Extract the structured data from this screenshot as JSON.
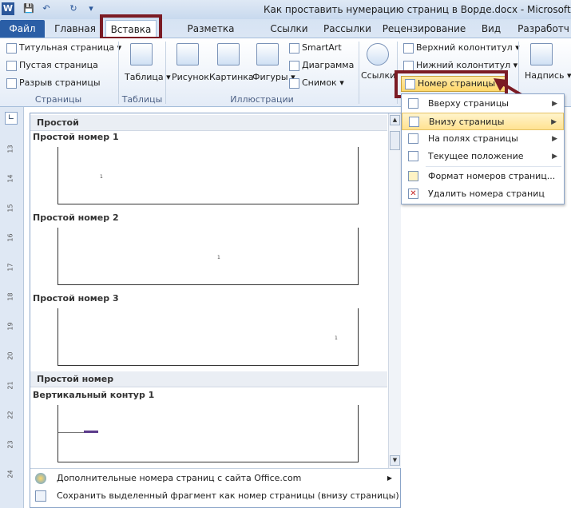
{
  "window": {
    "title": "Как проставить нумерацию страниц в Ворде.docx - Microsoft Word"
  },
  "tabs": [
    "Файл",
    "Главная",
    "Вставка",
    "Разметка страницы",
    "Ссылки",
    "Рассылки",
    "Рецензирование",
    "Вид",
    "Разработч"
  ],
  "ribbon": {
    "pages": {
      "title_page": "Титульная страница",
      "blank_page": "Пустая страница",
      "page_break": "Разрыв страницы",
      "group": "Страницы"
    },
    "tables": {
      "table": "Таблица",
      "group": "Таблицы"
    },
    "illustrations": {
      "picture": "Рисунок",
      "clipart": "Картинка",
      "shapes": "Фигуры",
      "smartart": "SmartArt",
      "chart": "Диаграмма",
      "screenshot": "Снимок",
      "group": "Иллюстрации"
    },
    "links": {
      "links": "Ссылки"
    },
    "header_footer": {
      "header": "Верхний колонтитул",
      "footer": "Нижний колонтитул",
      "page_number": "Номер страницы"
    },
    "text": {
      "textbox": "Надпись"
    }
  },
  "gallery": {
    "section1": "Простой",
    "items": [
      {
        "title": "Простой номер 1",
        "num": "1"
      },
      {
        "title": "Простой номер 2",
        "num": "1"
      },
      {
        "title": "Простой номер 3",
        "num": "1"
      }
    ],
    "section2": "Простой номер",
    "vertical_title": "Вертикальный контур 1",
    "footer1": "Дополнительные номера страниц с сайта Office.com",
    "footer2": "Сохранить выделенный фрагмент как номер страницы (внизу страницы)"
  },
  "menu": {
    "top": "Вверху страницы",
    "bottom": "Внизу страницы",
    "margins": "На полях страницы",
    "current": "Текущее положение",
    "format": "Формат номеров страниц...",
    "remove": "Удалить номера страниц"
  },
  "ruler": [
    "13",
    "14",
    "15",
    "16",
    "17",
    "18",
    "19",
    "20",
    "21",
    "22",
    "23",
    "24"
  ],
  "colors": {
    "accent": "#2a5ea6",
    "highlight": "#ffe291",
    "annotation": "#7b1b24"
  }
}
